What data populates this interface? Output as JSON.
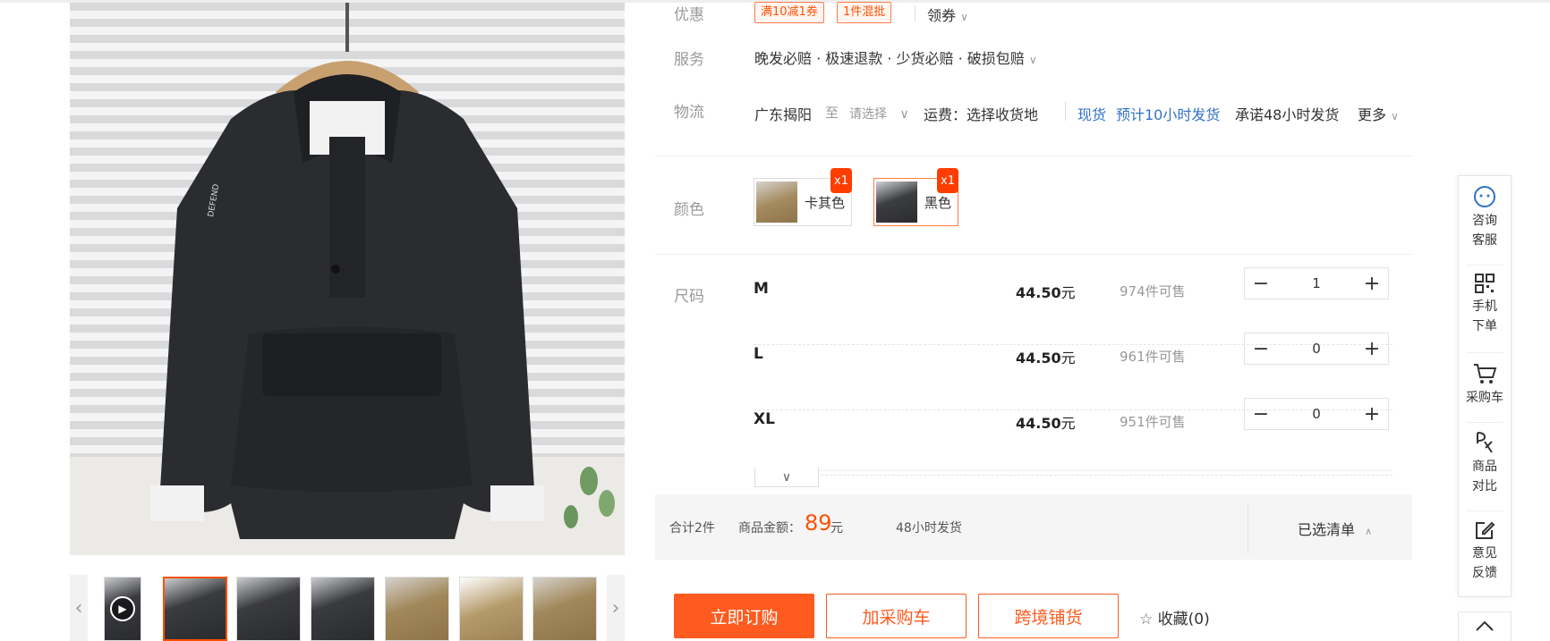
{
  "promo": {
    "label": "优惠",
    "tags": [
      "满10减1券",
      "1件混批"
    ],
    "coupon_label": "领券"
  },
  "service": {
    "label": "服务",
    "text": "晚发必赔 · 极速退款 · 少货必赔 · 破损包赔"
  },
  "logistics": {
    "label": "物流",
    "origin": "广东揭阳",
    "to": "至",
    "destination_placeholder": "请选择",
    "shipping": "运费：选择收货地",
    "stock_type": "现货",
    "eta": "预计10小时发货",
    "promise": "承诺48小时发货",
    "more": "更多"
  },
  "color": {
    "label": "颜色",
    "options": [
      {
        "name": "卡其色",
        "badge": "x1",
        "selected": false
      },
      {
        "name": "黑色",
        "badge": "x1",
        "selected": true
      }
    ]
  },
  "sizes": {
    "label": "尺码",
    "rows": [
      {
        "size": "M",
        "price": "44.50",
        "unit": "元",
        "stock": "974件可售",
        "qty": "1"
      },
      {
        "size": "L",
        "price": "44.50",
        "unit": "元",
        "stock": "961件可售",
        "qty": "0"
      },
      {
        "size": "XL",
        "price": "44.50",
        "unit": "元",
        "stock": "951件可售",
        "qty": "0"
      }
    ]
  },
  "summary": {
    "total_count": "合计2件",
    "amount_label": "商品金额：",
    "amount": "89",
    "amount_unit": "元",
    "ship_time": "48小时发货",
    "selected_list": "已选清单"
  },
  "actions": {
    "buy_now": "立即订购",
    "add_cart": "加采购车",
    "cross_border": "跨境铺货",
    "favorite": "收藏(0)"
  },
  "sidebar": {
    "items": [
      {
        "line1": "咨询",
        "line2": "客服",
        "icon": "chat-icon"
      },
      {
        "line1": "手机",
        "line2": "下单",
        "icon": "qrcode-icon"
      },
      {
        "line1": "采购车",
        "line2": "",
        "icon": "cart-icon"
      },
      {
        "line1": "商品",
        "line2": "对比",
        "icon": "compare-icon"
      },
      {
        "line1": "意见",
        "line2": "反馈",
        "icon": "feedback-icon"
      }
    ]
  },
  "colors": {
    "accent": "#ff5000",
    "link_blue": "#3071c7"
  }
}
